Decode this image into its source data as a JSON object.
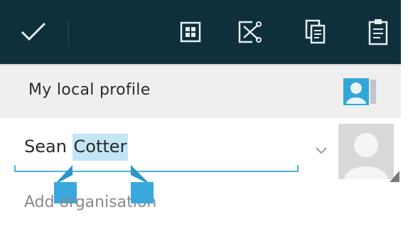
{
  "actionbar": {
    "colors": {
      "background": "#0f2f3d",
      "icon": "#e6eef2"
    },
    "done_icon": "checkmark-icon",
    "actions": [
      {
        "icon": "select-all-icon"
      },
      {
        "icon": "cut-icon"
      },
      {
        "icon": "copy-icon"
      },
      {
        "icon": "paste-icon"
      }
    ]
  },
  "section": {
    "title": "My local profile",
    "icon": "contact-card-icon"
  },
  "name_field": {
    "value_prefix": "Sean ",
    "value_selected": "Cotter",
    "selection_color": "#c3e6f6",
    "accent_color": "#4bb4de",
    "expand_icon": "chevron-down-icon",
    "avatar_icon": "default-avatar-icon"
  },
  "organisation_field": {
    "placeholder": "Add organisation"
  }
}
